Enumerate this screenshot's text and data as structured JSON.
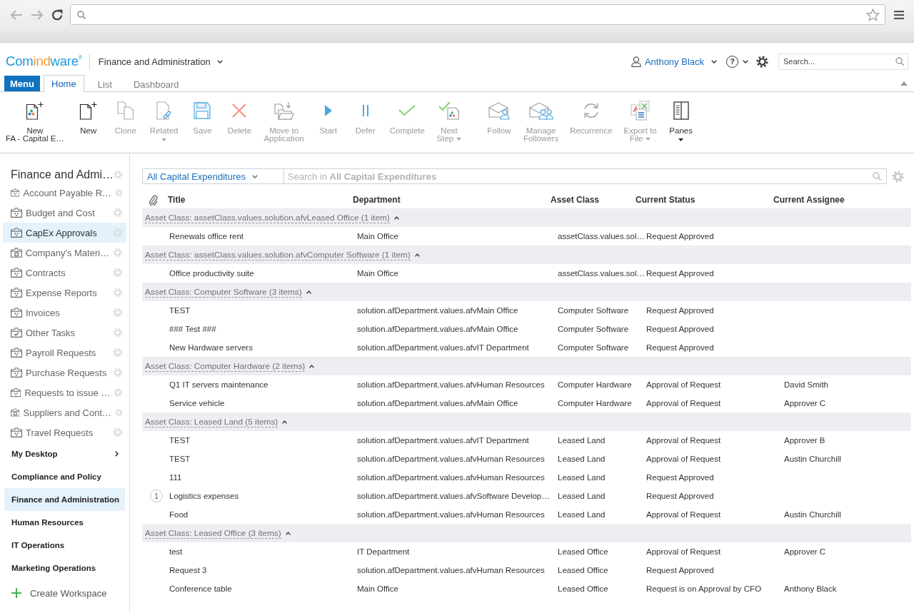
{
  "header": {
    "logo": [
      "Com",
      "ind",
      "ware",
      "®"
    ],
    "workspace": "Finance and Administration",
    "user": "Anthony Black",
    "help": "?",
    "search": {
      "placeholder": "Search..."
    }
  },
  "ribbon": {
    "menu": "Menu",
    "tabs": [
      {
        "label": "Home",
        "selected": true
      },
      {
        "label": "List",
        "selected": false
      },
      {
        "label": "Dashboard",
        "selected": false
      }
    ]
  },
  "toolbar": {
    "groups": [
      {
        "buttons": [
          {
            "label": "New\nFA - Capital E…",
            "disabled": false,
            "dropdown": false
          },
          {
            "label": "New",
            "disabled": false,
            "dropdown": false
          },
          {
            "label": "Clone",
            "disabled": true,
            "dropdown": false
          },
          {
            "label": "Related",
            "disabled": true,
            "dropdown": true
          },
          {
            "label": "Save",
            "disabled": true,
            "dropdown": false
          },
          {
            "label": "Delete",
            "disabled": true,
            "dropdown": false
          },
          {
            "label": "Move to\nApplication",
            "disabled": true,
            "dropdown": false
          },
          {
            "label": "Start",
            "disabled": true,
            "dropdown": false
          },
          {
            "label": "Defer",
            "disabled": true,
            "dropdown": false
          },
          {
            "label": "Complete",
            "disabled": true,
            "dropdown": false
          },
          {
            "label": "Next\nStep",
            "disabled": true,
            "dropdown": true
          }
        ]
      },
      {
        "buttons": [
          {
            "label": "Follow",
            "disabled": true,
            "dropdown": false
          },
          {
            "label": "Manage\nFollowers",
            "disabled": true,
            "dropdown": false
          },
          {
            "label": "Recurrence",
            "disabled": true,
            "dropdown": false
          },
          {
            "label": "Export to\nFile",
            "disabled": true,
            "dropdown": true
          },
          {
            "label": "Panes",
            "disabled": false,
            "dropdown": true
          }
        ]
      }
    ]
  },
  "sidebar": {
    "title": "Finance and Admi…",
    "items": [
      {
        "label": "Account Payable R…",
        "kind": "process",
        "selected": false
      },
      {
        "label": "Budget and Cost",
        "kind": "process",
        "selected": false
      },
      {
        "label": "CapEx Approvals",
        "kind": "process",
        "selected": true
      },
      {
        "label": "Company's Materi…",
        "kind": "record",
        "selected": false
      },
      {
        "label": "Contracts",
        "kind": "process",
        "selected": false
      },
      {
        "label": "Expense Reports",
        "kind": "process",
        "selected": false
      },
      {
        "label": "Invoices",
        "kind": "process",
        "selected": false
      },
      {
        "label": "Other Tasks",
        "kind": "tasks",
        "selected": false
      },
      {
        "label": "Payroll Requests",
        "kind": "process",
        "selected": false
      },
      {
        "label": "Purchase Requests",
        "kind": "process",
        "selected": false
      },
      {
        "label": "Requests to issue …",
        "kind": "process",
        "selected": false
      },
      {
        "label": "Suppliers and Cont…",
        "kind": "record",
        "selected": false
      },
      {
        "label": "Travel Requests",
        "kind": "process",
        "selected": false
      }
    ],
    "workspaces": [
      {
        "label": "My Desktop",
        "selected": false,
        "submenu": true
      },
      {
        "label": "Compliance and Policy",
        "selected": false,
        "submenu": false
      },
      {
        "label": "Finance and Administration",
        "selected": true,
        "submenu": false
      },
      {
        "label": "Human Resources",
        "selected": false,
        "submenu": false
      },
      {
        "label": "IT Operations",
        "selected": false,
        "submenu": false
      },
      {
        "label": "Marketing Operations",
        "selected": false,
        "submenu": false
      }
    ],
    "create": "Create Workspace"
  },
  "view": {
    "filter": "All Capital Expenditures",
    "search": {
      "placeholder": "Search in **All Capital Expenditures**"
    }
  },
  "table": {
    "columns": [
      "Title",
      "Department",
      "Asset Class",
      "Current Status",
      "Current Assignee"
    ],
    "groups": [
      {
        "label": "Asset Class: assetClass.values.solution.afvLeased Office (1 item)",
        "expanded": true,
        "rows": [
          {
            "title": "Renewals office rent",
            "department": "Main Office",
            "asset_class": "assetClass.values.sol…",
            "status": "Request Approved"
          }
        ]
      },
      {
        "label": "Asset Class: assetClass.values.solution.afvComputer Software (1 item)",
        "expanded": true,
        "rows": [
          {
            "title": "Office productivity suite",
            "department": "Main Office",
            "asset_class": "assetClass.values.sol…",
            "status": "Request Approved"
          }
        ]
      },
      {
        "label": "Asset Class: Computer Software (3 items)",
        "expanded": true,
        "rows": [
          {
            "title": "TEST",
            "department": "solution.afDepartment.values.afvMain Office",
            "asset_class": "Computer Software",
            "status": "Request Approved"
          },
          {
            "title": "### Test ###",
            "department": "solution.afDepartment.values.afvMain Office",
            "asset_class": "Computer Software",
            "status": "Request Approved"
          },
          {
            "title": "New Hardware servers",
            "department": "solution.afDepartment.values.afvIT Department",
            "asset_class": "Computer Software",
            "status": "Request Approved"
          }
        ]
      },
      {
        "label": "Asset Class: Computer Hardware (2 items)",
        "expanded": true,
        "rows": [
          {
            "title": "Q1 IT servers maintenance",
            "department": "solution.afDepartment.values.afvHuman Resources",
            "asset_class": "Computer Hardware",
            "status": "Approval of Request",
            "assignee": "David Smith"
          },
          {
            "title": "Service vehicle",
            "department": "solution.afDepartment.values.afvMain Office",
            "asset_class": "Computer Hardware",
            "status": "Approval of Request",
            "assignee": "Approver C"
          }
        ]
      },
      {
        "label": "Asset Class: Leased Land (5 items)",
        "expanded": true,
        "rows": [
          {
            "title": "TEST",
            "department": "solution.afDepartment.values.afvIT Department",
            "asset_class": "Leased Land",
            "status": "Approval of Request",
            "assignee": "Approver B"
          },
          {
            "title": "TEST",
            "department": "solution.afDepartment.values.afvHuman Resources",
            "asset_class": "Leased Land",
            "status": "Approval of Request",
            "assignee": "Austin Churchill"
          },
          {
            "title": "111",
            "department": "solution.afDepartment.values.afvHuman Resources",
            "asset_class": "Leased Land",
            "status": "Request Approved"
          },
          {
            "badge": "1",
            "title": "Logistics expenses",
            "department": "solution.afDepartment.values.afvSoftware Develop…",
            "asset_class": "Leased Land",
            "status": "Request Approved"
          },
          {
            "title": "Food",
            "department": "solution.afDepartment.values.afvHuman Resources",
            "asset_class": "Leased Land",
            "status": "Approval of Request",
            "assignee": "Austin Churchill"
          }
        ]
      },
      {
        "label": "Asset Class: Leased Office (3 items)",
        "expanded": true,
        "rows": [
          {
            "title": "test",
            "department": "IT Department",
            "asset_class": "Leased Office",
            "status": "Approval of Request",
            "assignee": "Approver C"
          },
          {
            "title": "Request 3",
            "department": "solution.afDepartment.values.afvHuman Resources",
            "asset_class": "Leased Office",
            "status": "Request Approved"
          },
          {
            "title": "Conference table",
            "department": "Main Office",
            "asset_class": "Leased Office",
            "status": "Request is on Approval by CFO",
            "assignee": "Anthony Black"
          }
        ]
      }
    ]
  }
}
